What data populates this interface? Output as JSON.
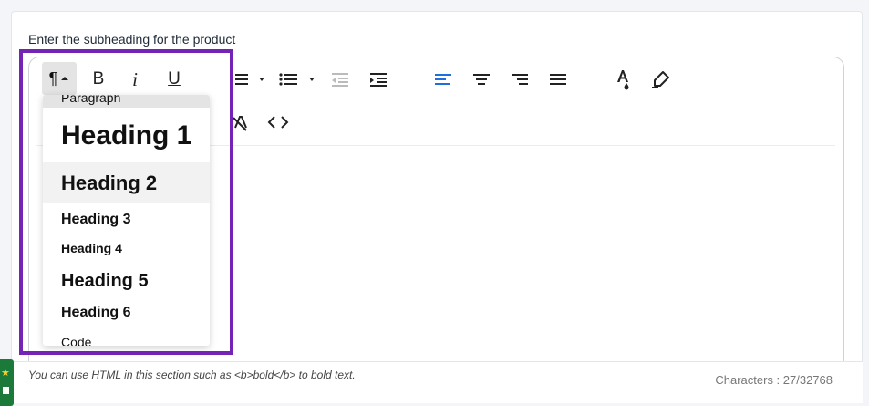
{
  "field": {
    "label": "Enter the subheading for the product",
    "hint": "You can use HTML in this section such as <b>bold</b> to bold text.",
    "char_count": "Characters : 27/32768"
  },
  "toolbar": {
    "paragraph_glyph": "¶",
    "bold": "B",
    "italic": "i",
    "underline": "U"
  },
  "format_dropdown": {
    "items": [
      {
        "label": "Paragraph"
      },
      {
        "label": "Heading 1"
      },
      {
        "label": "Heading 2"
      },
      {
        "label": "Heading 3"
      },
      {
        "label": "Heading 4"
      },
      {
        "label": "Heading 5"
      },
      {
        "label": "Heading 6"
      },
      {
        "label": "Code"
      }
    ]
  },
  "colors": {
    "highlight": "#7523b5",
    "accent": "#1e6fd9",
    "badge": "#1b7a3a"
  },
  "icons": [
    "paragraph-icon",
    "bold-icon",
    "italic-icon",
    "underline-icon",
    "ordered-list-icon",
    "unordered-list-icon",
    "outdent-icon",
    "indent-icon",
    "align-left-icon",
    "align-center-icon",
    "align-right-icon",
    "justify-icon",
    "text-color-icon",
    "highlight-icon",
    "clear-format-icon",
    "code-icon"
  ]
}
